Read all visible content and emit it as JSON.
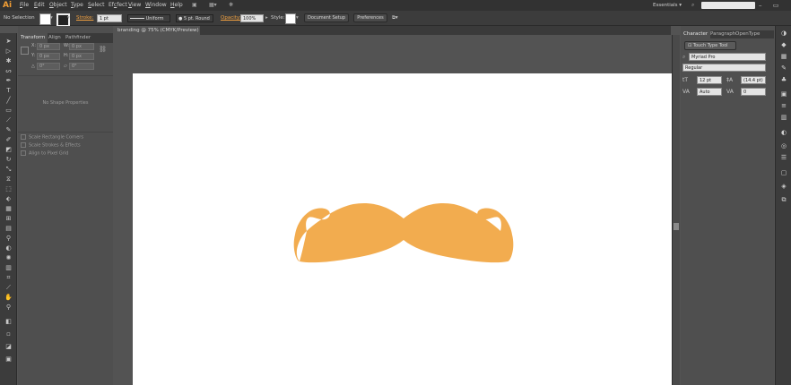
{
  "app": {
    "logo": "Ai"
  },
  "menu": [
    "File",
    "Edit",
    "Object",
    "Type",
    "Select",
    "Effect",
    "View",
    "Window",
    "Help"
  ],
  "menu_ul": [
    "F",
    "E",
    "O",
    "T",
    "S",
    "c",
    "V",
    "W",
    "H"
  ],
  "menu_rest": [
    "ile",
    "dit",
    "bject",
    "ype",
    "elect",
    "fect",
    "iew",
    "indow",
    "elp"
  ],
  "menu_pre": [
    "",
    "",
    "",
    "",
    "",
    "Ef",
    "",
    "",
    ""
  ],
  "workspace": {
    "label": "Essentials ▾"
  },
  "window_controls": "– ▭ ✕",
  "control_bar": {
    "selection": "No Selection",
    "stroke_label": "Stroke:",
    "stroke_weight": "1 pt",
    "profile": "Uniform",
    "brush": "5 pt. Round",
    "opacity_label": "Opacity:",
    "opacity_value": "100%",
    "style_label": "Style:",
    "doc_setup": "Document Setup",
    "preferences": "Preferences"
  },
  "left_panel": {
    "tabs": [
      "Transform",
      "Align",
      "Pathfinder"
    ],
    "x_label": "X:",
    "x_value": "0 px",
    "y_label": "Y:",
    "y_value": "0 px",
    "w_label": "W:",
    "w_value": "0 px",
    "h_label": "H:",
    "h_value": "0 px",
    "rot_value": "0°",
    "shear_value": "0°",
    "no_shape": "No Shape Properties",
    "checkboxes": [
      "Scale Rectangle Corners",
      "Scale Strokes & Effects",
      "Align to Pixel Grid"
    ]
  },
  "document": {
    "tab": "branding @ 75% (CMYK/Preview)",
    "close": "×"
  },
  "right_panel": {
    "tabs": [
      "Character",
      "Paragraph",
      "OpenType"
    ],
    "touch_type": "Touch Type Tool",
    "font_family": "Myriad Pro",
    "font_style": "Regular",
    "font_size": "12 pt",
    "leading": "(14.4 pt)",
    "kerning": "Auto",
    "tracking": "0"
  },
  "colors": {
    "mustache": "#f2ac4f",
    "accent": "#f29e35"
  }
}
